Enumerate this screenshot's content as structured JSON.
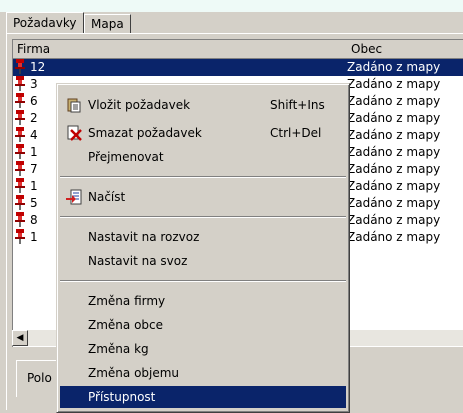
{
  "tabs": [
    {
      "label": "Požadavky"
    },
    {
      "label": "Mapa"
    }
  ],
  "columns": {
    "firma": "Firma",
    "obec": "Obec"
  },
  "rows": [
    {
      "firma": "12",
      "obec": "Zadáno z mapy"
    },
    {
      "firma": "3",
      "obec": "Zadáno z mapy"
    },
    {
      "firma": "6",
      "obec": "Zadáno z mapy"
    },
    {
      "firma": "2",
      "obec": "Zadáno z mapy"
    },
    {
      "firma": "4",
      "obec": "Zadáno z mapy"
    },
    {
      "firma": "1",
      "obec": "Zadáno z mapy"
    },
    {
      "firma": "7",
      "obec": "Zadáno z mapy"
    },
    {
      "firma": "1",
      "obec": "Zadáno z mapy"
    },
    {
      "firma": "5",
      "obec": "Zadáno z mapy"
    },
    {
      "firma": "8",
      "obec": "Zadáno z mapy"
    },
    {
      "firma": "1",
      "obec": "Zadáno z mapy"
    }
  ],
  "lower_tab": {
    "label": "Polo"
  },
  "context_menu": {
    "items": [
      {
        "label": "Vložit požadavek",
        "shortcut": "Shift+Ins",
        "icon": "paste-icon"
      },
      {
        "label": "Smazat požadavek",
        "shortcut": "Ctrl+Del",
        "icon": "delete-icon"
      },
      {
        "label": "Přejmenovat",
        "shortcut": ""
      },
      {
        "label": "Načíst",
        "shortcut": "",
        "icon": "load-icon"
      },
      {
        "label": "Nastavit na rozvoz",
        "shortcut": ""
      },
      {
        "label": "Nastavit na svoz",
        "shortcut": ""
      },
      {
        "label": "Změna firmy",
        "shortcut": ""
      },
      {
        "label": "Změna obce",
        "shortcut": ""
      },
      {
        "label": "Změna kg",
        "shortcut": ""
      },
      {
        "label": "Změna objemu",
        "shortcut": ""
      },
      {
        "label": "Přístupnost",
        "shortcut": "",
        "highlighted": true
      }
    ]
  },
  "colors": {
    "selection": "#0a246a",
    "pin": "#c00000",
    "face": "#d4d0c8"
  }
}
